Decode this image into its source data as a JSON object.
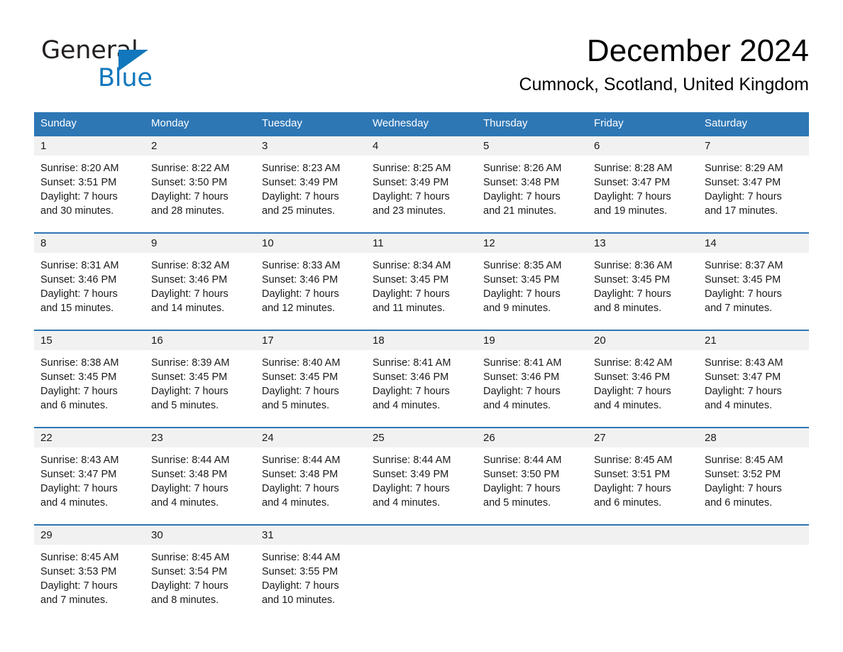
{
  "brand": {
    "name_part1": "General",
    "name_part2": "Blue",
    "accent_color": "#1277bc"
  },
  "header": {
    "title": "December 2024",
    "subtitle": "Cumnock, Scotland, United Kingdom"
  },
  "theme": {
    "header_row_color": "#2e77b5",
    "daynum_band_color": "#f1f1f1",
    "text_color": "#1a1a1a"
  },
  "weekdays": [
    "Sunday",
    "Monday",
    "Tuesday",
    "Wednesday",
    "Thursday",
    "Friday",
    "Saturday"
  ],
  "weeks": [
    {
      "numbers": [
        "1",
        "2",
        "3",
        "4",
        "5",
        "6",
        "7"
      ],
      "cells": [
        {
          "l1": "Sunrise: 8:20 AM",
          "l2": "Sunset: 3:51 PM",
          "l3": "Daylight: 7 hours",
          "l4": "and 30 minutes."
        },
        {
          "l1": "Sunrise: 8:22 AM",
          "l2": "Sunset: 3:50 PM",
          "l3": "Daylight: 7 hours",
          "l4": "and 28 minutes."
        },
        {
          "l1": "Sunrise: 8:23 AM",
          "l2": "Sunset: 3:49 PM",
          "l3": "Daylight: 7 hours",
          "l4": "and 25 minutes."
        },
        {
          "l1": "Sunrise: 8:25 AM",
          "l2": "Sunset: 3:49 PM",
          "l3": "Daylight: 7 hours",
          "l4": "and 23 minutes."
        },
        {
          "l1": "Sunrise: 8:26 AM",
          "l2": "Sunset: 3:48 PM",
          "l3": "Daylight: 7 hours",
          "l4": "and 21 minutes."
        },
        {
          "l1": "Sunrise: 8:28 AM",
          "l2": "Sunset: 3:47 PM",
          "l3": "Daylight: 7 hours",
          "l4": "and 19 minutes."
        },
        {
          "l1": "Sunrise: 8:29 AM",
          "l2": "Sunset: 3:47 PM",
          "l3": "Daylight: 7 hours",
          "l4": "and 17 minutes."
        }
      ]
    },
    {
      "numbers": [
        "8",
        "9",
        "10",
        "11",
        "12",
        "13",
        "14"
      ],
      "cells": [
        {
          "l1": "Sunrise: 8:31 AM",
          "l2": "Sunset: 3:46 PM",
          "l3": "Daylight: 7 hours",
          "l4": "and 15 minutes."
        },
        {
          "l1": "Sunrise: 8:32 AM",
          "l2": "Sunset: 3:46 PM",
          "l3": "Daylight: 7 hours",
          "l4": "and 14 minutes."
        },
        {
          "l1": "Sunrise: 8:33 AM",
          "l2": "Sunset: 3:46 PM",
          "l3": "Daylight: 7 hours",
          "l4": "and 12 minutes."
        },
        {
          "l1": "Sunrise: 8:34 AM",
          "l2": "Sunset: 3:45 PM",
          "l3": "Daylight: 7 hours",
          "l4": "and 11 minutes."
        },
        {
          "l1": "Sunrise: 8:35 AM",
          "l2": "Sunset: 3:45 PM",
          "l3": "Daylight: 7 hours",
          "l4": "and 9 minutes."
        },
        {
          "l1": "Sunrise: 8:36 AM",
          "l2": "Sunset: 3:45 PM",
          "l3": "Daylight: 7 hours",
          "l4": "and 8 minutes."
        },
        {
          "l1": "Sunrise: 8:37 AM",
          "l2": "Sunset: 3:45 PM",
          "l3": "Daylight: 7 hours",
          "l4": "and 7 minutes."
        }
      ]
    },
    {
      "numbers": [
        "15",
        "16",
        "17",
        "18",
        "19",
        "20",
        "21"
      ],
      "cells": [
        {
          "l1": "Sunrise: 8:38 AM",
          "l2": "Sunset: 3:45 PM",
          "l3": "Daylight: 7 hours",
          "l4": "and 6 minutes."
        },
        {
          "l1": "Sunrise: 8:39 AM",
          "l2": "Sunset: 3:45 PM",
          "l3": "Daylight: 7 hours",
          "l4": "and 5 minutes."
        },
        {
          "l1": "Sunrise: 8:40 AM",
          "l2": "Sunset: 3:45 PM",
          "l3": "Daylight: 7 hours",
          "l4": "and 5 minutes."
        },
        {
          "l1": "Sunrise: 8:41 AM",
          "l2": "Sunset: 3:46 PM",
          "l3": "Daylight: 7 hours",
          "l4": "and 4 minutes."
        },
        {
          "l1": "Sunrise: 8:41 AM",
          "l2": "Sunset: 3:46 PM",
          "l3": "Daylight: 7 hours",
          "l4": "and 4 minutes."
        },
        {
          "l1": "Sunrise: 8:42 AM",
          "l2": "Sunset: 3:46 PM",
          "l3": "Daylight: 7 hours",
          "l4": "and 4 minutes."
        },
        {
          "l1": "Sunrise: 8:43 AM",
          "l2": "Sunset: 3:47 PM",
          "l3": "Daylight: 7 hours",
          "l4": "and 4 minutes."
        }
      ]
    },
    {
      "numbers": [
        "22",
        "23",
        "24",
        "25",
        "26",
        "27",
        "28"
      ],
      "cells": [
        {
          "l1": "Sunrise: 8:43 AM",
          "l2": "Sunset: 3:47 PM",
          "l3": "Daylight: 7 hours",
          "l4": "and 4 minutes."
        },
        {
          "l1": "Sunrise: 8:44 AM",
          "l2": "Sunset: 3:48 PM",
          "l3": "Daylight: 7 hours",
          "l4": "and 4 minutes."
        },
        {
          "l1": "Sunrise: 8:44 AM",
          "l2": "Sunset: 3:48 PM",
          "l3": "Daylight: 7 hours",
          "l4": "and 4 minutes."
        },
        {
          "l1": "Sunrise: 8:44 AM",
          "l2": "Sunset: 3:49 PM",
          "l3": "Daylight: 7 hours",
          "l4": "and 4 minutes."
        },
        {
          "l1": "Sunrise: 8:44 AM",
          "l2": "Sunset: 3:50 PM",
          "l3": "Daylight: 7 hours",
          "l4": "and 5 minutes."
        },
        {
          "l1": "Sunrise: 8:45 AM",
          "l2": "Sunset: 3:51 PM",
          "l3": "Daylight: 7 hours",
          "l4": "and 6 minutes."
        },
        {
          "l1": "Sunrise: 8:45 AM",
          "l2": "Sunset: 3:52 PM",
          "l3": "Daylight: 7 hours",
          "l4": "and 6 minutes."
        }
      ]
    },
    {
      "numbers": [
        "29",
        "30",
        "31",
        "",
        "",
        "",
        ""
      ],
      "cells": [
        {
          "l1": "Sunrise: 8:45 AM",
          "l2": "Sunset: 3:53 PM",
          "l3": "Daylight: 7 hours",
          "l4": "and 7 minutes."
        },
        {
          "l1": "Sunrise: 8:45 AM",
          "l2": "Sunset: 3:54 PM",
          "l3": "Daylight: 7 hours",
          "l4": "and 8 minutes."
        },
        {
          "l1": "Sunrise: 8:44 AM",
          "l2": "Sunset: 3:55 PM",
          "l3": "Daylight: 7 hours",
          "l4": "and 10 minutes."
        },
        {
          "l1": "",
          "l2": "",
          "l3": "",
          "l4": ""
        },
        {
          "l1": "",
          "l2": "",
          "l3": "",
          "l4": ""
        },
        {
          "l1": "",
          "l2": "",
          "l3": "",
          "l4": ""
        },
        {
          "l1": "",
          "l2": "",
          "l3": "",
          "l4": ""
        }
      ]
    }
  ]
}
